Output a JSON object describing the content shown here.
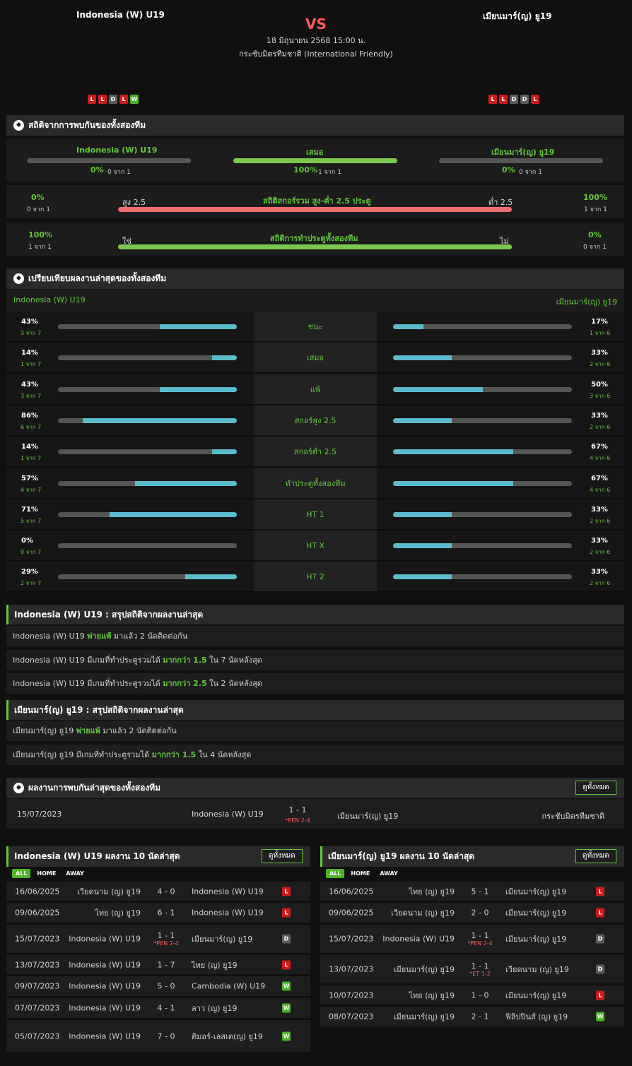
{
  "header": {
    "home": "Indonesia (W) U19",
    "away": "เมียนมาร์(ญ) ยู19",
    "vs": "VS",
    "datetime": "18 มิถุนายน 2568 15:00 น.",
    "competition": "กระชับมิตรทีมชาติ (International Friendly)",
    "home_form": [
      "L",
      "L",
      "D",
      "L",
      "W"
    ],
    "away_form": [
      "L",
      "L",
      "D",
      "D",
      "L"
    ]
  },
  "h2h_stats": {
    "title": "สถิติจากการพบกันของทั้งสองทีม",
    "home_label": "Indonesia (W) U19",
    "draw_label": "เสมอ",
    "away_label": "เมียนมาร์(ญ) ยู19",
    "home_pct": "0%",
    "home_sub": "0 จาก 1",
    "draw_pct": "100%",
    "draw_sub": "1 จาก 1",
    "away_pct": "0%",
    "away_sub": "0 จาก 1",
    "home_value": 0,
    "draw_value": 100,
    "away_value": 0,
    "ou": {
      "title": "สถิติสกอร์รวม สูง-ต่ำ 2.5 ประตู",
      "left_label": "สูง 2.5",
      "right_label": "ต่ำ 2.5",
      "left_pct": "0%",
      "left_sub": "0 จาก 1",
      "right_pct": "100%",
      "right_sub": "1 จาก 1",
      "left_value": 0
    },
    "btts": {
      "title": "สถิติการทำประตูทั้งสองทีม",
      "left_label": "ใช่",
      "right_label": "ไม่",
      "left_pct": "100%",
      "left_sub": "1 จาก 1",
      "right_pct": "0%",
      "right_sub": "0 จาก 1",
      "left_value": 100
    }
  },
  "compare": {
    "title": "เปรียบเทียบผลงานล่าสุดของทั้งสองทีม",
    "home": "Indonesia (W) U19",
    "away": "เมียนมาร์(ญ) ยู19",
    "rows": [
      {
        "label": "ชนะ",
        "home_pct": "43%",
        "home_sub": "3 จาก 7",
        "home_value": 43,
        "away_pct": "17%",
        "away_sub": "1 จาก 6",
        "away_value": 17
      },
      {
        "label": "เสมอ",
        "home_pct": "14%",
        "home_sub": "1 จาก 7",
        "home_value": 14,
        "away_pct": "33%",
        "away_sub": "2 จาก 6",
        "away_value": 33
      },
      {
        "label": "แพ้",
        "home_pct": "43%",
        "home_sub": "3 จาก 7",
        "home_value": 43,
        "away_pct": "50%",
        "away_sub": "3 จาก 6",
        "away_value": 50
      },
      {
        "label": "สกอร์สูง 2.5",
        "home_pct": "86%",
        "home_sub": "6 จาก 7",
        "home_value": 86,
        "away_pct": "33%",
        "away_sub": "2 จาก 6",
        "away_value": 33
      },
      {
        "label": "สกอร์ต่ำ 2.5",
        "home_pct": "14%",
        "home_sub": "1 จาก 7",
        "home_value": 14,
        "away_pct": "67%",
        "away_sub": "4 จาก 6",
        "away_value": 67
      },
      {
        "label": "ทำประตูทั้งสองทีม",
        "home_pct": "57%",
        "home_sub": "4 จาก 7",
        "home_value": 57,
        "away_pct": "67%",
        "away_sub": "4 จาก 6",
        "away_value": 67
      },
      {
        "label": "HT 1",
        "home_pct": "71%",
        "home_sub": "5 จาก 7",
        "home_value": 71,
        "away_pct": "33%",
        "away_sub": "2 จาก 6",
        "away_value": 33
      },
      {
        "label": "HT X",
        "home_pct": "0%",
        "home_sub": "0 จาก 7",
        "home_value": 0,
        "away_pct": "33%",
        "away_sub": "2 จาก 6",
        "away_value": 33
      },
      {
        "label": "HT 2",
        "home_pct": "29%",
        "home_sub": "2 จาก 7",
        "home_value": 29,
        "away_pct": "33%",
        "away_sub": "2 จาก 6",
        "away_value": 33
      }
    ]
  },
  "home_summary": {
    "title": "Indonesia (W) U19 : สรุปสถิติจากผลงานล่าสุด",
    "rows": [
      {
        "a": "Indonesia (W) U19",
        "b": "พ่ายแพ้",
        "c": "มาแล้ว 2 นัดติดต่อกัน"
      },
      {
        "a": "Indonesia (W) U19  มีเกมที่ทำประตูรวมได้",
        "b": "มากกว่า  1.5",
        "c": "ใน 7 นัดหลังสุด"
      },
      {
        "a": "Indonesia (W) U19  มีเกมที่ทำประตูรวมได้",
        "b": "มากกว่า  2.5",
        "c": "ใน 2 นัดหลังสุด"
      }
    ]
  },
  "away_summary": {
    "title": "เมียนมาร์(ญ) ยู19 : สรุปสถิติจากผลงานล่าสุด",
    "rows": [
      {
        "a": "เมียนมาร์(ญ) ยู19",
        "b": "พ่ายแพ้",
        "c": "มาแล้ว 2 นัดติดต่อกัน"
      },
      {
        "a": "เมียนมาร์(ญ) ยู19  มีเกมที่ทำประตูรวมได้",
        "b": "มากกว่า  1.5",
        "c": "ใน 4 นัดหลังสุด"
      }
    ]
  },
  "h2h_results": {
    "title": "ผลงานการพบกันล่าสุดของทั้งสองทีม",
    "view_all": "ดูทั้งหมด",
    "match": {
      "date": "15/07/2023",
      "home": "Indonesia (W) U19",
      "score": "1 - 1",
      "note": "*PEN 2-4",
      "away": "เมียนมาร์(ญ) ยู19",
      "competition": "กระชับมิตรทีมชาติ"
    }
  },
  "home_last10": {
    "title": "Indonesia (W) U19 ผลงาน 10 นัดล่าสุด",
    "view_all": "ดูทั้งหมด",
    "tabs": [
      "ALL",
      "HOME",
      "AWAY"
    ],
    "matches": [
      {
        "date": "16/06/2025",
        "home": "เวียดนาม (ญ) ยู19",
        "score": "4 - 0",
        "note": "",
        "away": "Indonesia (W) U19",
        "result": "L"
      },
      {
        "date": "09/06/2025",
        "home": "ไทย (ญ) ยู19",
        "score": "6 - 1",
        "note": "",
        "away": "Indonesia (W) U19",
        "result": "L"
      },
      {
        "date": "15/07/2023",
        "home": "Indonesia (W) U19",
        "score": "1 - 1",
        "note": "*PEN 2-4",
        "away": "เมียนมาร์(ญ) ยู19",
        "result": "D"
      },
      {
        "date": "13/07/2023",
        "home": "Indonesia (W) U19",
        "score": "1 - 7",
        "note": "",
        "away": "ไทย (ญ) ยู19",
        "result": "L"
      },
      {
        "date": "09/07/2023",
        "home": "Indonesia (W) U19",
        "score": "5 - 0",
        "note": "",
        "away": "Cambodia (W) U19",
        "result": "W"
      },
      {
        "date": "07/07/2023",
        "home": "Indonesia (W) U19",
        "score": "4 - 1",
        "note": "",
        "away": "ลาว (ญ) ยู19",
        "result": "W"
      },
      {
        "date": "05/07/2023",
        "home": "Indonesia (W) U19",
        "score": "7 - 0",
        "note": "",
        "away": "ติมอร์-เลสเต(ญ) ยู19",
        "result": "W"
      }
    ]
  },
  "away_last10": {
    "title": "เมียนมาร์(ญ) ยู19 ผลงาน 10 นัดล่าสุด",
    "view_all": "ดูทั้งหมด",
    "tabs": [
      "ALL",
      "HOME",
      "AWAY"
    ],
    "matches": [
      {
        "date": "16/06/2025",
        "home": "ไทย (ญ) ยู19",
        "score": "5 - 1",
        "note": "",
        "away": "เมียนมาร์(ญ) ยู19",
        "result": "L"
      },
      {
        "date": "09/06/2025",
        "home": "เวียดนาม (ญ) ยู19",
        "score": "2 - 0",
        "note": "",
        "away": "เมียนมาร์(ญ) ยู19",
        "result": "L"
      },
      {
        "date": "15/07/2023",
        "home": "Indonesia (W) U19",
        "score": "1 - 1",
        "note": "*PEN 2-4",
        "away": "เมียนมาร์(ญ) ยู19",
        "result": "D"
      },
      {
        "date": "13/07/2023",
        "home": "เมียนมาร์(ญ) ยู19",
        "score": "1 - 1",
        "note": "*ET 1-2",
        "away": "เวียดนาม (ญ) ยู19",
        "result": "D"
      },
      {
        "date": "10/07/2023",
        "home": "ไทย (ญ) ยู19",
        "score": "1 - 0",
        "note": "",
        "away": "เมียนมาร์(ญ) ยู19",
        "result": "L"
      },
      {
        "date": "08/07/2023",
        "home": "เมียนมาร์(ญ) ยู19",
        "score": "2 - 1",
        "note": "",
        "away": "ฟิลิปปินส์ (ญ) ยู19",
        "result": "W"
      }
    ]
  },
  "colors": {
    "accent": "#62c83a",
    "bar_teal": "#5bbccc",
    "bar_red": "#ee6e6e",
    "win": "#4ab524",
    "loss": "#d11a1a",
    "draw": "#5c5c5c"
  }
}
